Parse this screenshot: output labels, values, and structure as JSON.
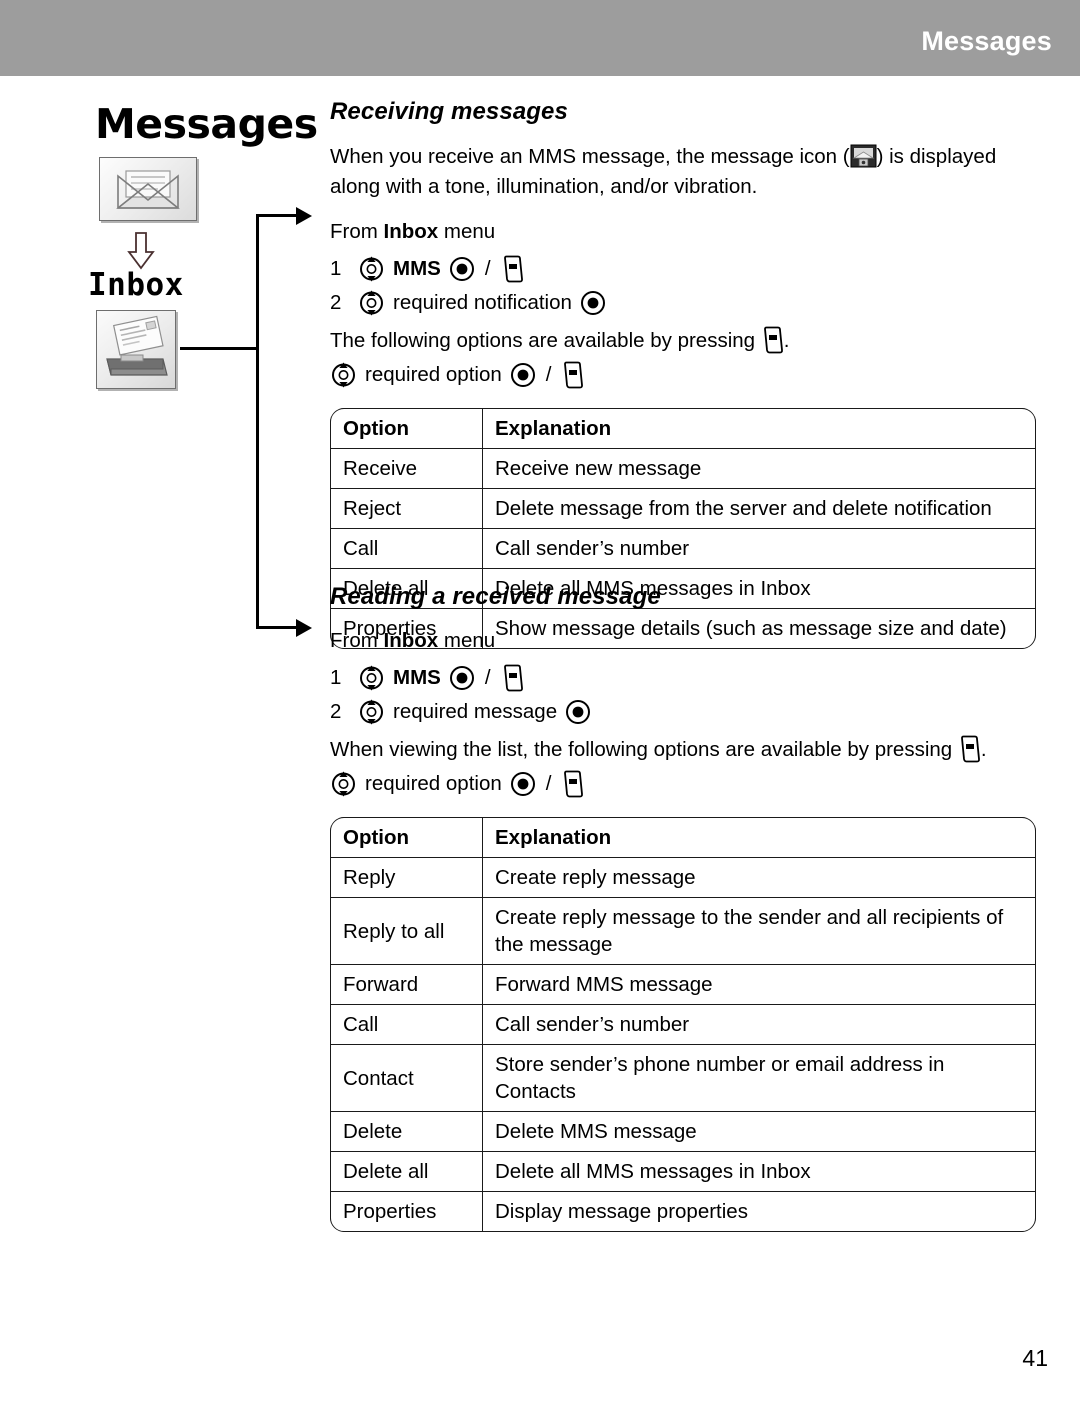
{
  "header": {
    "title": "Messages"
  },
  "rail": {
    "title": "Messages",
    "sublabel": "Inbox",
    "envelope_icon": "envelope-icon",
    "tray_icon": "inbox-tray-icon",
    "down_arrow_icon": "down-arrow-icon"
  },
  "icons": {
    "nav_key": "navigation-key-icon",
    "select_key": "select-key-icon",
    "soft_key": "soft-key-icon",
    "message_indicator": "message-indicator-icon"
  },
  "sections": [
    {
      "heading": "Receiving messages",
      "intro_before": "When you receive an MMS message, the message icon (",
      "intro_after": ") is displayed along with a tone, illumination, and/or vibration.",
      "from_prefix": "From ",
      "from_menu": "Inbox",
      "from_suffix": " menu",
      "steps": [
        {
          "num": "1",
          "label": "MMS",
          "bold": true
        },
        {
          "num": "2",
          "label": "required notification",
          "bold": false
        }
      ],
      "options_intro_before": "The following options are available by pressing ",
      "options_intro_after": ".",
      "option_select_label": "required option",
      "table": {
        "headers": [
          "Option",
          "Explanation"
        ],
        "rows": [
          [
            "Receive",
            "Receive new message"
          ],
          [
            "Reject",
            "Delete message from the server and delete notification"
          ],
          [
            "Call",
            "Call sender’s number"
          ],
          [
            "Delete all",
            "Delete all MMS messages in Inbox"
          ],
          [
            "Properties",
            "Show message details (such as message size and date)"
          ]
        ]
      }
    },
    {
      "heading": "Reading a received message",
      "from_prefix": "From ",
      "from_menu": "Inbox",
      "from_suffix": " menu",
      "steps": [
        {
          "num": "1",
          "label": "MMS",
          "bold": true
        },
        {
          "num": "2",
          "label": "required message",
          "bold": false
        }
      ],
      "options_intro_before": "When viewing the list, the following options are available by pressing ",
      "options_intro_after": ".",
      "option_select_label": "required option",
      "table": {
        "headers": [
          "Option",
          "Explanation"
        ],
        "rows": [
          [
            "Reply",
            "Create reply message"
          ],
          [
            "Reply to all",
            "Create reply message to the sender and all recipients of the message"
          ],
          [
            "Forward",
            "Forward MMS message"
          ],
          [
            "Call",
            "Call sender’s number"
          ],
          [
            "Contact",
            "Store sender’s phone number or email address in Contacts"
          ],
          [
            "Delete",
            "Delete MMS message"
          ],
          [
            "Delete all",
            "Delete all MMS messages in Inbox"
          ],
          [
            "Properties",
            "Display message properties"
          ]
        ]
      }
    }
  ],
  "footer": {
    "page_number": "41"
  },
  "colors": {
    "header_bar": "#9d9d9d",
    "header_text": "#ffffff",
    "body_text": "#000000"
  }
}
